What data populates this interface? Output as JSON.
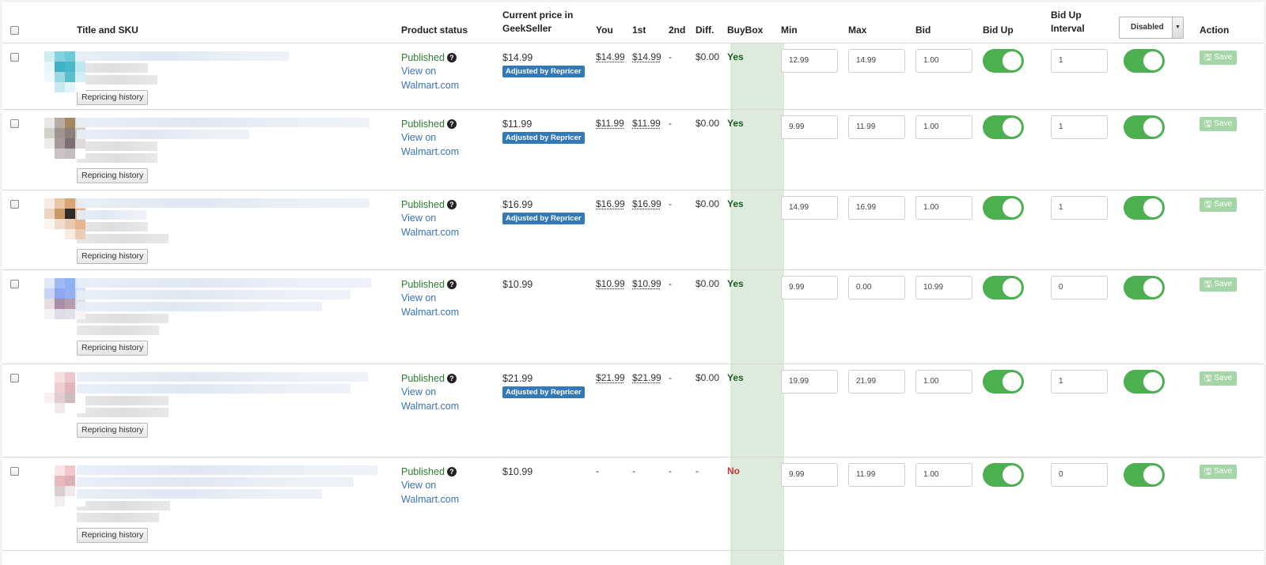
{
  "header": {
    "title_sku": "Title and SKU",
    "product_status": "Product status",
    "current_price": "Current price in GeekSeller",
    "you": "You",
    "first": "1st",
    "second": "2nd",
    "diff": "Diff.",
    "buybox": "BuyBox",
    "min": "Min",
    "max": "Max",
    "bid": "Bid",
    "bid_up": "Bid Up",
    "bid_up_interval": "Bid Up Interval",
    "select_value": "Disabled",
    "action": "Action"
  },
  "labels": {
    "repricing_history": "Repricing history",
    "view_on": "View on Walmart.com",
    "adjusted": "Adjusted by Repricer",
    "save": "Save",
    "help": "?"
  },
  "colors": {
    "published": "#2e7d32",
    "link": "#3a74b5",
    "badge": "#3479b7",
    "toggle_on": "#4caf50",
    "buybox_bg": "#dcebdc",
    "no": "#d32f2f",
    "save": "#a5d6a7"
  },
  "rows": [
    {
      "status": "Published",
      "price": "$14.99",
      "adjusted": true,
      "you": "$14.99",
      "first": "$14.99",
      "second": "-",
      "diff": "$0.00",
      "buybox": "Yes",
      "min": "12.99",
      "max": "14.99",
      "bid": "1.00",
      "bid_up": true,
      "interval": "1",
      "enabled": true
    },
    {
      "status": "Published",
      "price": "$11.99",
      "adjusted": true,
      "you": "$11.99",
      "first": "$11.99",
      "second": "-",
      "diff": "$0.00",
      "buybox": "Yes",
      "min": "9.99",
      "max": "11.99",
      "bid": "1.00",
      "bid_up": true,
      "interval": "1",
      "enabled": true
    },
    {
      "status": "Published",
      "price": "$16.99",
      "adjusted": true,
      "you": "$16.99",
      "first": "$16.99",
      "second": "-",
      "diff": "$0.00",
      "buybox": "Yes",
      "min": "14.99",
      "max": "16.99",
      "bid": "1.00",
      "bid_up": true,
      "interval": "1",
      "enabled": true
    },
    {
      "status": "Published",
      "price": "$10.99",
      "adjusted": false,
      "you": "$10.99",
      "first": "$10.99",
      "second": "-",
      "diff": "$0.00",
      "buybox": "Yes",
      "min": "9.99",
      "max": "0.00",
      "bid": "10.99",
      "bid_up": true,
      "interval": "0",
      "enabled": true
    },
    {
      "status": "Published",
      "price": "$21.99",
      "adjusted": true,
      "you": "$21.99",
      "first": "$21.99",
      "second": "-",
      "diff": "$0.00",
      "buybox": "Yes",
      "min": "19.99",
      "max": "21.99",
      "bid": "1.00",
      "bid_up": true,
      "interval": "1",
      "enabled": true
    },
    {
      "status": "Published",
      "price": "$10.99",
      "adjusted": false,
      "you": "-",
      "first": "-",
      "second": "-",
      "diff": "-",
      "buybox": "No",
      "min": "9.99",
      "max": "11.99",
      "bid": "1.00",
      "bid_up": true,
      "interval": "0",
      "enabled": true
    }
  ]
}
